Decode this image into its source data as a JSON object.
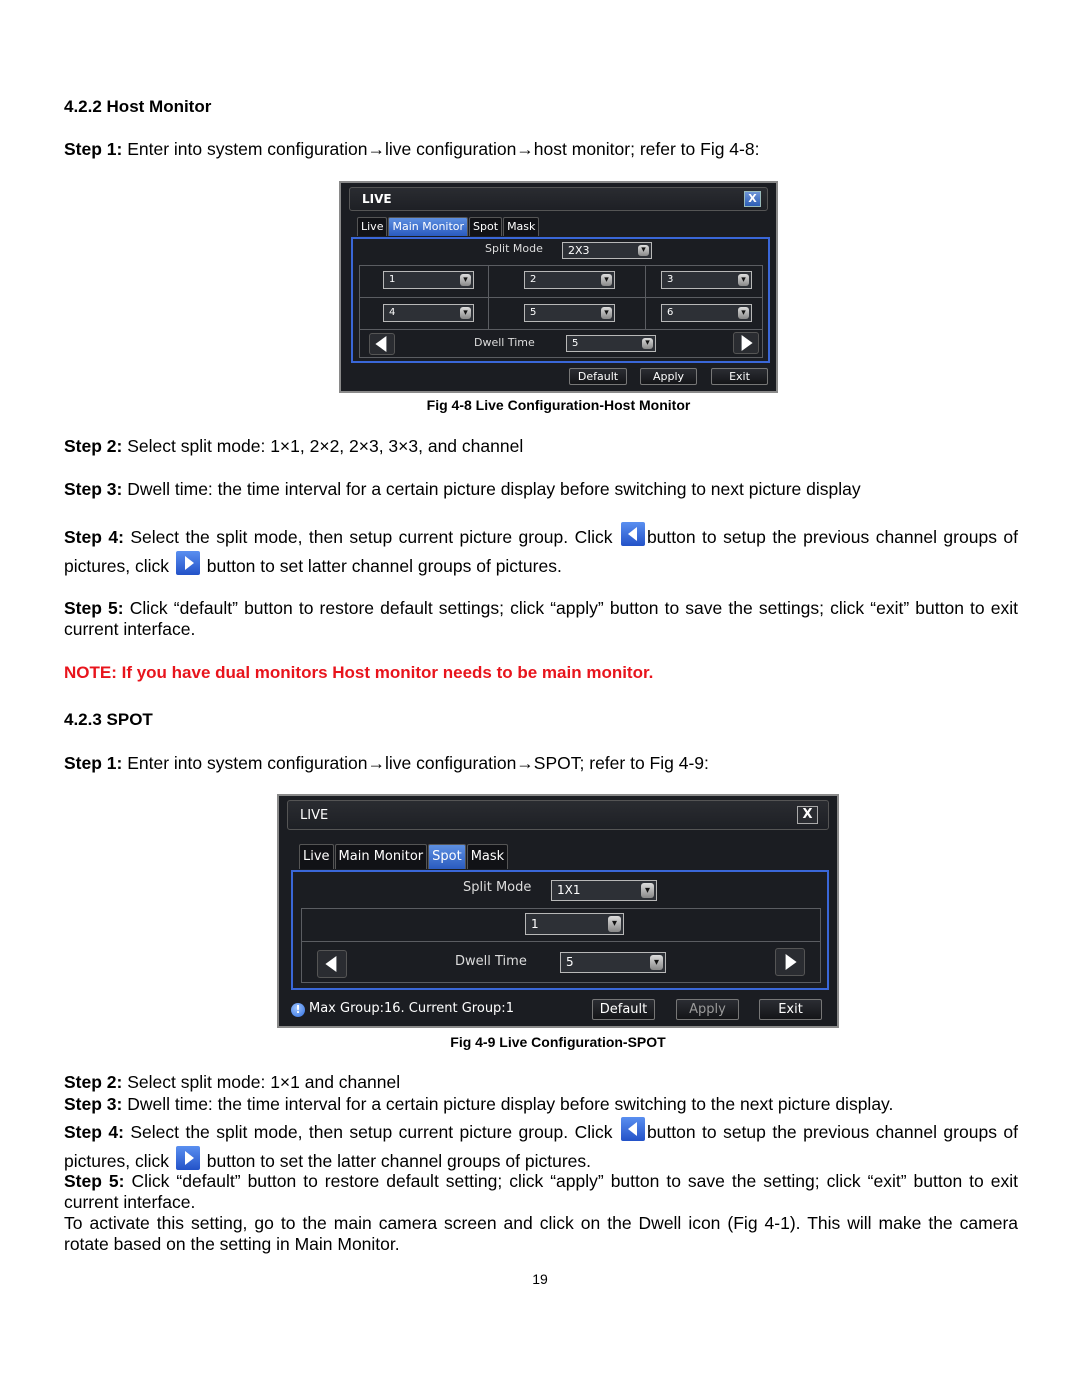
{
  "section_host": {
    "heading": "4.2.2 Host Monitor",
    "step1": {
      "label": "Step 1:",
      "text": " Enter into system configuration→live configuration→host monitor; refer to Fig 4-8:"
    },
    "figure": {
      "caption": "Fig 4-8 Live Configuration-Host Monitor",
      "dialog": {
        "title": "LIVE",
        "close_glyph": "X",
        "tabs": [
          {
            "label": "Live",
            "active": false
          },
          {
            "label": "Main Monitor",
            "active": true
          },
          {
            "label": "Spot",
            "active": false
          },
          {
            "label": "Mask",
            "active": false
          }
        ],
        "split_mode_label": "Split Mode",
        "split_mode_value": "2X3",
        "channels": [
          "1",
          "2",
          "3",
          "4",
          "5",
          "6"
        ],
        "dwell_time_label": "Dwell Time",
        "dwell_time_value": "5",
        "dropdown_glyph": "▾",
        "buttons": {
          "default": "Default",
          "apply": "Apply",
          "exit": "Exit"
        }
      }
    },
    "step2": {
      "label": "Step 2:",
      "text": " Select split mode: 1×1, 2×2, 2×3, 3×3, and channel"
    },
    "step3": {
      "label": "Step 3:",
      "text": " Dwell time: the time interval for a certain picture display before switching to next picture display"
    },
    "step4": {
      "label": "Step 4:",
      "text_a": " Select the split mode, then setup current picture group. Click ",
      "text_b": "button to setup the previous channel groups of pictures, click ",
      "text_c": " button to set latter channel groups of pictures."
    },
    "step5": {
      "label": "Step 5:",
      "text": " Click “default” button to restore default settings; click “apply” button to save the settings; click “exit” button to exit current interface."
    },
    "note": "NOTE: If you have dual monitors Host monitor needs to be main monitor."
  },
  "section_spot": {
    "heading": "4.2.3 SPOT",
    "step1": {
      "label": "Step 1:",
      "text": " Enter into system configuration→live configuration→SPOT; refer to Fig 4-9:"
    },
    "figure": {
      "caption": "Fig 4-9 Live Configuration-SPOT",
      "dialog": {
        "title": "LIVE",
        "close_glyph": "X",
        "tabs": [
          {
            "label": "Live",
            "active": false
          },
          {
            "label": "Main Monitor",
            "active": false
          },
          {
            "label": "Spot",
            "active": true
          },
          {
            "label": "Mask",
            "active": false
          }
        ],
        "split_mode_label": "Split Mode",
        "split_mode_value": "1X1",
        "channel_value": "1",
        "dwell_time_label": "Dwell Time",
        "dwell_time_value": "5",
        "dropdown_glyph": "▾",
        "info_glyph": "!",
        "info_text": "Max  Group:16.  Current  Group:1",
        "buttons": {
          "default": "Default",
          "apply": "Apply",
          "exit": "Exit"
        }
      }
    },
    "step2": {
      "label": "Step 2:",
      "text": " Select split mode: 1×1 and channel"
    },
    "step3": {
      "label": "Step 3:",
      "text": " Dwell time: the time interval for a certain picture display before switching to the next picture display."
    },
    "step4": {
      "label": "Step 4:",
      "text_a": " Select the split mode, then setup current picture group. Click ",
      "text_b": "button to setup the previous channel groups of pictures, click ",
      "text_c": " button to set the latter channel groups of pictures."
    },
    "step5": {
      "label": "Step 5:",
      "text": " Click “default” button to restore default setting; click “apply” button to save the setting; click “exit” button to exit current interface."
    },
    "activate": "To activate this setting, go to the main camera screen and click on the Dwell icon (Fig 4-1). This will make the camera rotate based on the setting in Main Monitor."
  },
  "page_number": "19"
}
